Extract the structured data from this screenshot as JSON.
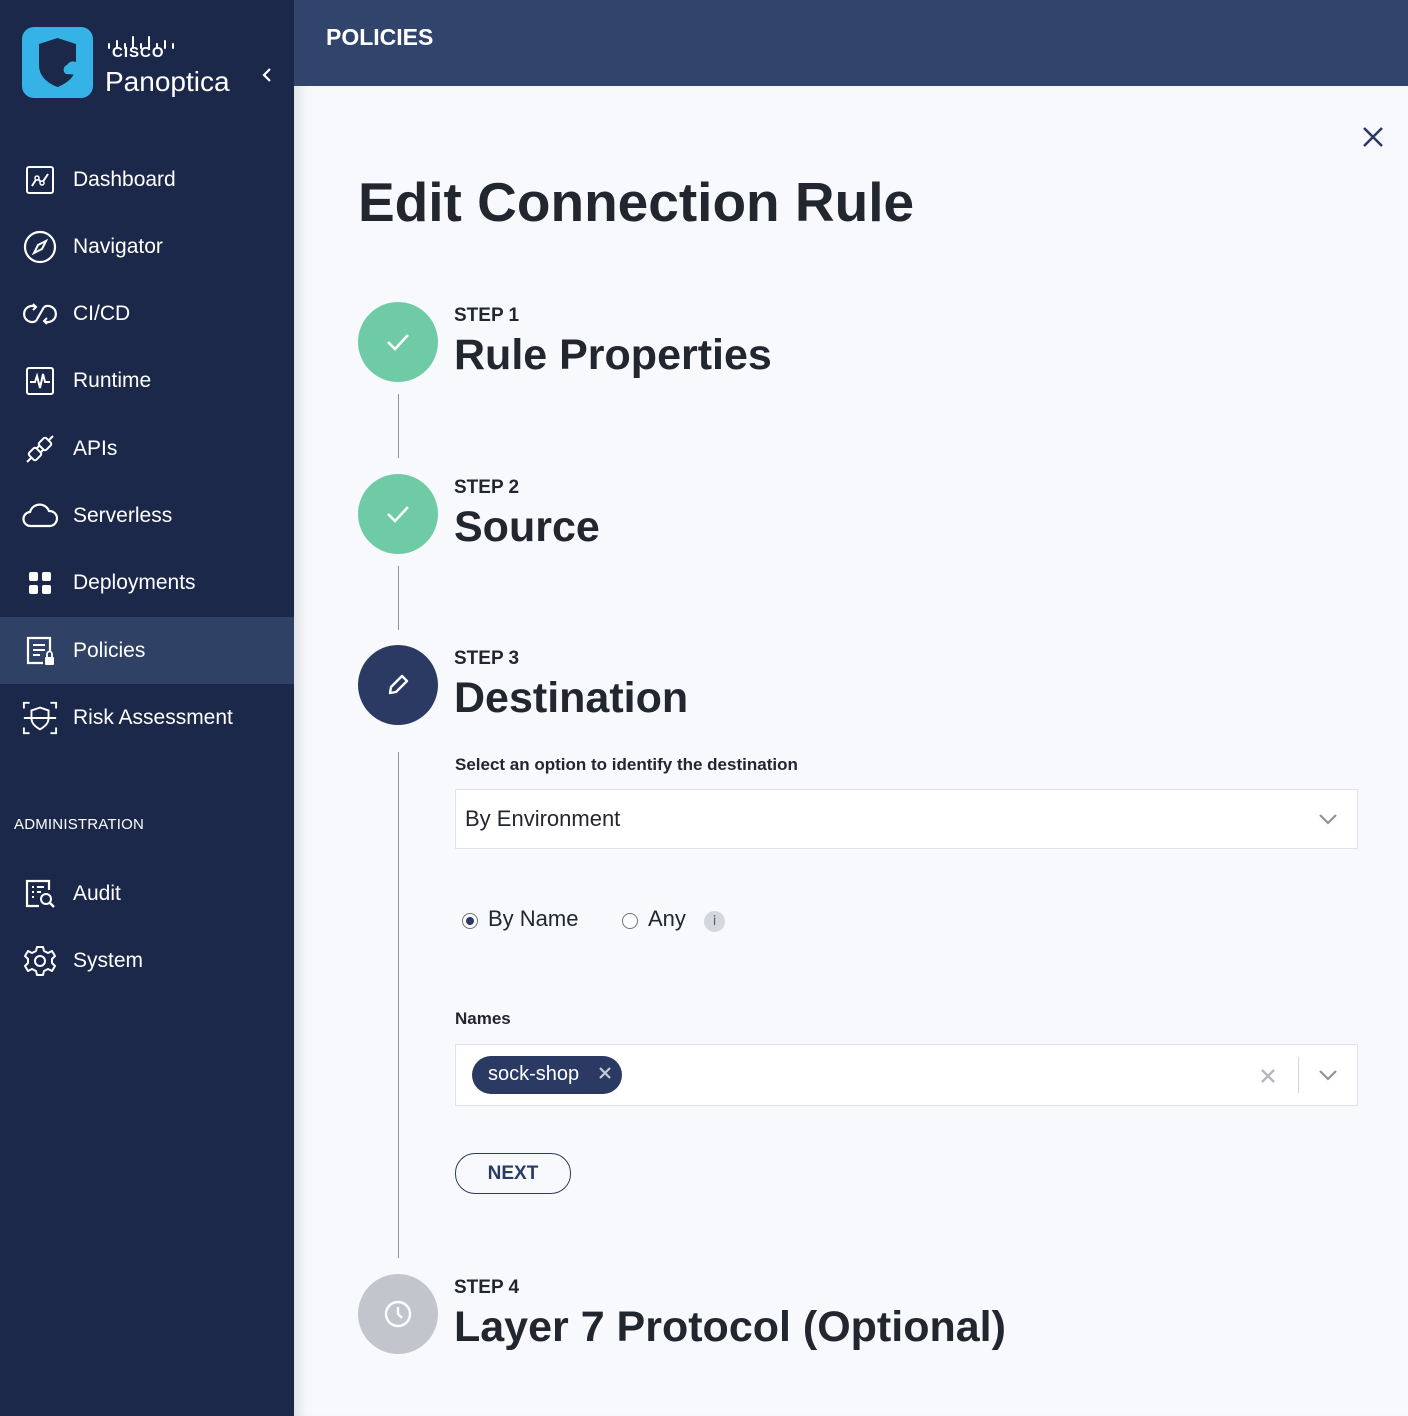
{
  "brand": {
    "company": "CISCO",
    "product": "Panoptica"
  },
  "sidebar": {
    "items": [
      {
        "label": "Dashboard",
        "icon": "dashboard-icon"
      },
      {
        "label": "Navigator",
        "icon": "compass-icon"
      },
      {
        "label": "CI/CD",
        "icon": "cicd-icon"
      },
      {
        "label": "Runtime",
        "icon": "runtime-icon"
      },
      {
        "label": "APIs",
        "icon": "api-plug-icon"
      },
      {
        "label": "Serverless",
        "icon": "cloud-icon"
      },
      {
        "label": "Deployments",
        "icon": "grid-icon"
      },
      {
        "label": "Policies",
        "icon": "policy-icon",
        "active": true
      },
      {
        "label": "Risk Assessment",
        "icon": "shield-scan-icon"
      }
    ],
    "admin_section_label": "ADMINISTRATION",
    "admin_items": [
      {
        "label": "Audit",
        "icon": "audit-icon"
      },
      {
        "label": "System",
        "icon": "gear-icon"
      }
    ]
  },
  "header": {
    "title": "POLICIES"
  },
  "dialog": {
    "title": "Edit Connection Rule",
    "steps": [
      {
        "number": "STEP 1",
        "title": "Rule Properties",
        "status": "completed"
      },
      {
        "number": "STEP 2",
        "title": "Source",
        "status": "completed"
      },
      {
        "number": "STEP 3",
        "title": "Destination",
        "status": "current"
      },
      {
        "number": "STEP 4",
        "title": "Layer 7 Protocol (Optional)",
        "status": "pending"
      }
    ],
    "destination": {
      "identify_label": "Select an option to identify the destination",
      "identify_value": "By Environment",
      "radio_options": [
        {
          "label": "By Name",
          "checked": true
        },
        {
          "label": "Any",
          "checked": false
        }
      ],
      "info_glyph": "i",
      "names_label": "Names",
      "names_selected": [
        "sock-shop"
      ]
    },
    "next_button": "NEXT"
  },
  "colors": {
    "sidebar_bg": "#1b2849",
    "topbar_bg": "#31446b",
    "active_nav_bg": "#2f4165",
    "step_done": "#6fcba6",
    "step_current": "#2a3a63",
    "step_pending": "#c2c5cb",
    "brand_blue": "#35b3e6"
  }
}
